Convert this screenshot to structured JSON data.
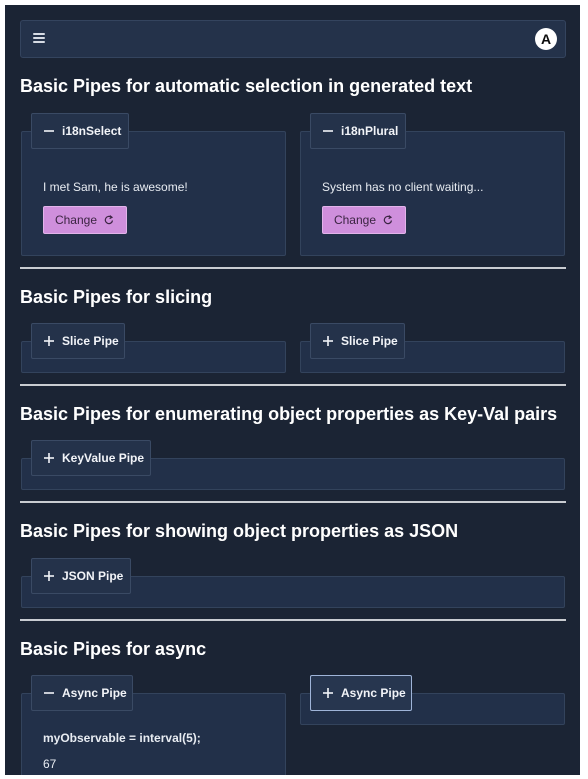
{
  "toolbar": {
    "menu_icon": "menu-icon",
    "logo_icon": "angular-logo-icon",
    "logo_letter": "A"
  },
  "colors": {
    "background": "#1b2434",
    "panel": "#223049",
    "tab": "#24324a",
    "button": "#cf8fdc",
    "divider": "#c9ccd1"
  },
  "sections": {
    "select": {
      "title": "Basic Pipes for automatic selection in generated text",
      "i18nselect": {
        "label": "i18nSelect",
        "icon": "minus-icon",
        "expanded": true,
        "text": "I met Sam, he is awesome!",
        "button_label": "Change",
        "button_icon": "refresh-icon"
      },
      "i18nplural": {
        "label": "i18nPlural",
        "icon": "minus-icon",
        "expanded": true,
        "text": "System has no client waiting...",
        "button_label": "Change",
        "button_icon": "refresh-icon"
      }
    },
    "slicing": {
      "title": "Basic Pipes for slicing",
      "panels": [
        {
          "label": "Slice Pipe",
          "icon": "plus-icon",
          "expanded": false
        },
        {
          "label": "Slice Pipe",
          "icon": "plus-icon",
          "expanded": false
        }
      ]
    },
    "keyvalue": {
      "title": "Basic Pipes for enumerating object properties as Key-Val pairs",
      "panel": {
        "label": "KeyValue Pipe",
        "icon": "plus-icon",
        "expanded": false
      }
    },
    "json": {
      "title": "Basic Pipes for showing object properties as JSON",
      "panel": {
        "label": "JSON Pipe",
        "icon": "plus-icon",
        "expanded": false
      }
    },
    "async": {
      "title": "Basic Pipes for async",
      "panels": [
        {
          "label": "Async Pipe",
          "icon": "minus-icon",
          "expanded": true,
          "code": "myObservable = interval(5);",
          "value": "67"
        },
        {
          "label": "Async Pipe",
          "icon": "plus-icon",
          "expanded": false,
          "focused": true
        }
      ]
    }
  }
}
